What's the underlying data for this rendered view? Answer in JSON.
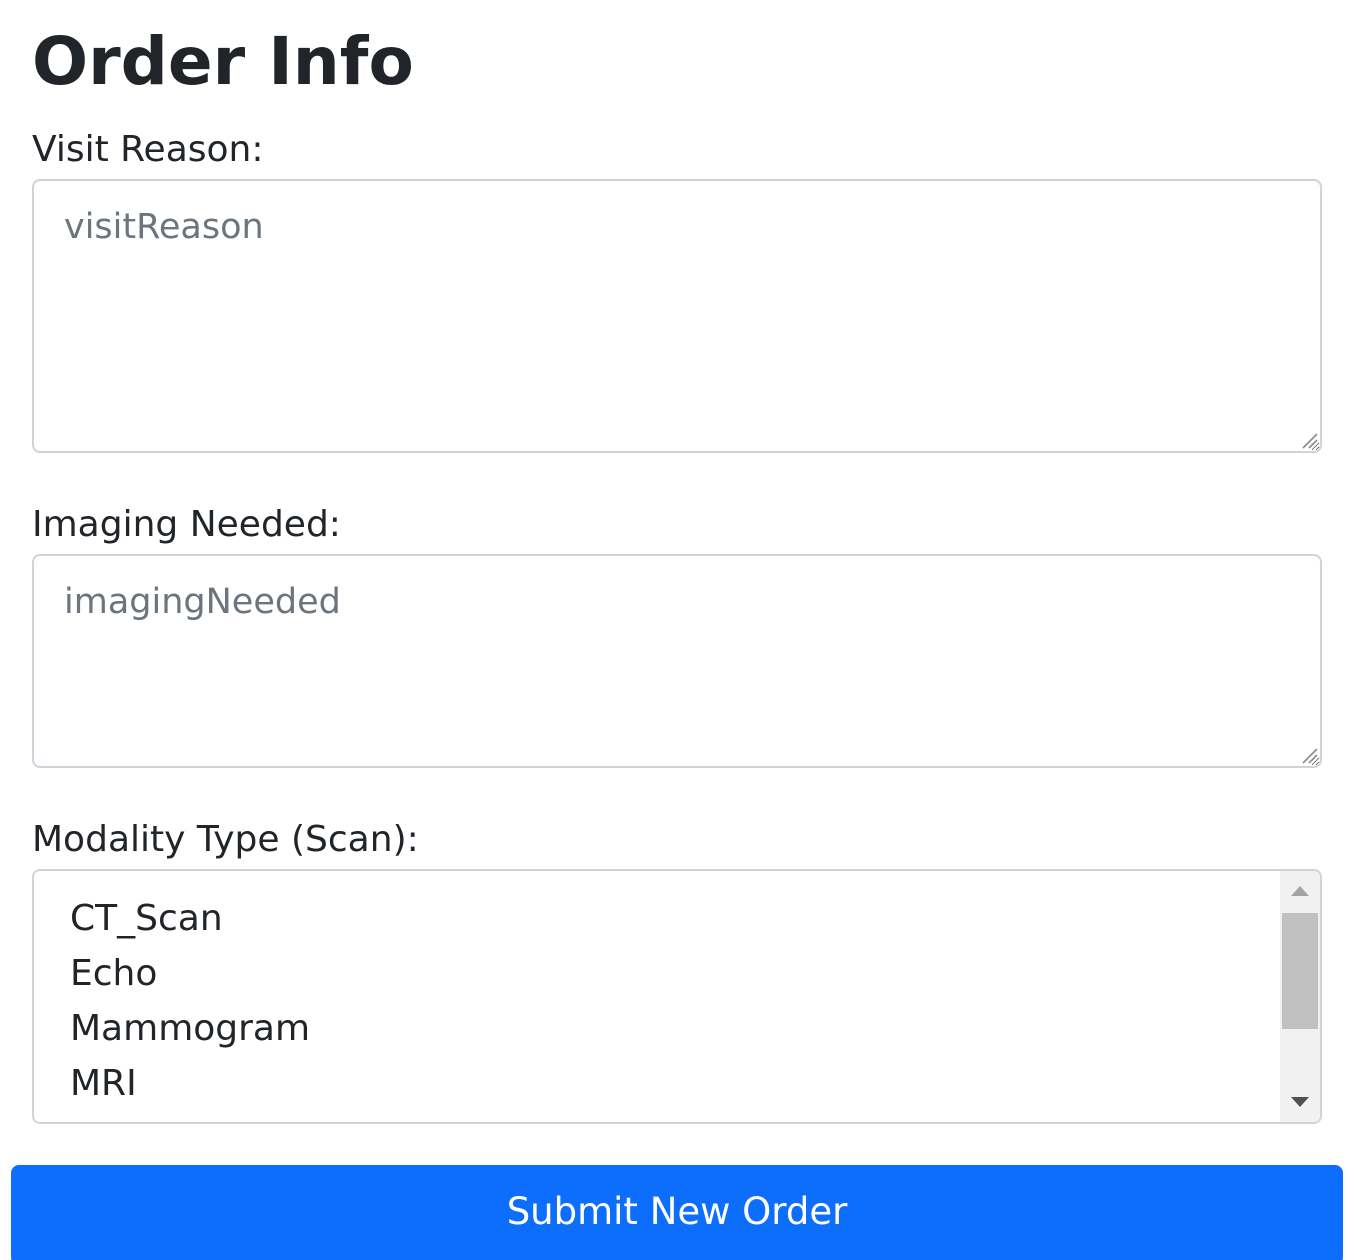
{
  "page": {
    "title": "Order Info"
  },
  "visit_reason": {
    "label": "Visit Reason:",
    "placeholder": "visitReason",
    "value": ""
  },
  "imaging_needed": {
    "label": "Imaging Needed:",
    "placeholder": "imagingNeeded",
    "value": ""
  },
  "modality": {
    "label": "Modality Type (Scan):",
    "options": [
      "CT_Scan",
      "Echo",
      "Mammogram",
      "MRI"
    ]
  },
  "submit": {
    "label": "Submit New Order"
  },
  "colors": {
    "primary_button": "#0d6efd",
    "text": "#212529",
    "placeholder": "#6c757d",
    "border": "#ced4da"
  }
}
